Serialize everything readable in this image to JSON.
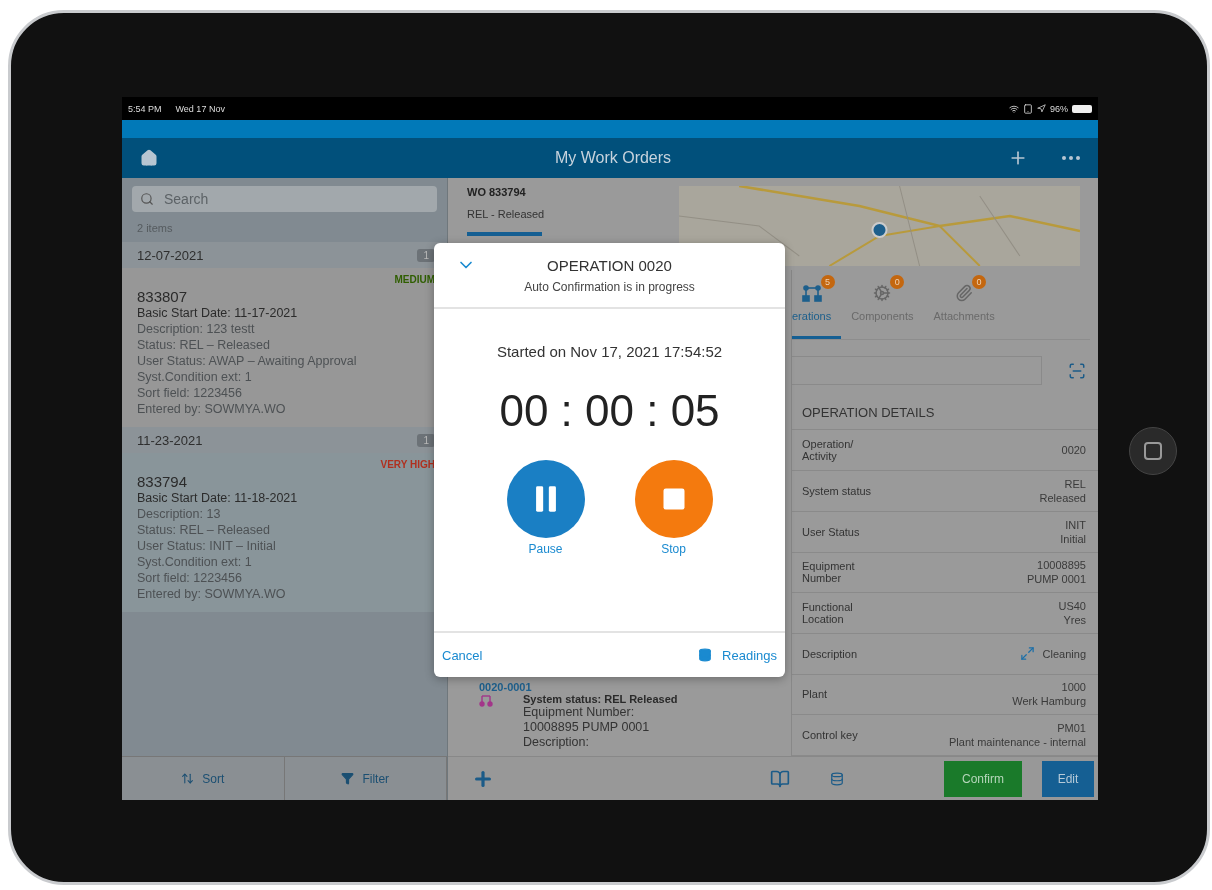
{
  "status_bar": {
    "time": "5:54 PM",
    "date": "Wed 17 Nov",
    "battery": "96%"
  },
  "nav": {
    "title": "My Work Orders"
  },
  "list": {
    "search_placeholder": "Search",
    "count": "2 items",
    "groups": [
      {
        "date": "12-07-2021",
        "count": "1",
        "orders": [
          {
            "id": "833807",
            "priority": "MEDIUM",
            "color": "#2f5e00",
            "selected": false,
            "start": "Basic Start Date: 11-17-2021",
            "lines": [
              "Description: 123 testt",
              "Status: REL – Released",
              "User Status:  AWAP – Awaiting Approval",
              "Syst.Condition ext: 1",
              "Sort field: 1223456",
              "Entered by: SOWMYA.WO"
            ]
          }
        ]
      },
      {
        "date": "11-23-2021",
        "count": "1",
        "orders": [
          {
            "id": "833794",
            "priority": "VERY HIGH",
            "color": "#b0301f",
            "selected": true,
            "start": "Basic Start Date: 11-18-2021",
            "lines": [
              "Description: 13",
              "Status: REL – Released",
              "User Status:  INIT – Initial",
              "Syst.Condition ext: 1",
              "Sort field: 1223456",
              "Entered by: SOWMYA.WO"
            ]
          }
        ]
      }
    ],
    "tools": [
      {
        "label": "Sort",
        "kind": "sort"
      },
      {
        "label": "Filter",
        "kind": "filter"
      }
    ]
  },
  "order": {
    "title": "WO 833794",
    "status": "REL - Released",
    "tabs": [
      {
        "label": "erations",
        "badge": "5",
        "kind": "operations",
        "selected": true
      },
      {
        "label": "Components",
        "badge": "0",
        "kind": "components",
        "selected": false
      },
      {
        "label": "Attachments",
        "badge": "0",
        "kind": "attachments",
        "selected": false
      }
    ],
    "details_heading": "OPERATION DETAILS",
    "details": [
      {
        "label": "Operation/ Activity",
        "values": [
          "0020"
        ],
        "kind": "text"
      },
      {
        "label": "System status",
        "values": [
          "REL",
          "Released"
        ],
        "kind": "text"
      },
      {
        "label": "User Status",
        "values": [
          "INIT",
          "Initial"
        ],
        "kind": "text"
      },
      {
        "label": "Equipment Number",
        "values": [
          "10008895",
          "PUMP 0001"
        ],
        "kind": "text"
      },
      {
        "label": "Functional Location",
        "values": [
          "US40",
          "Yres"
        ],
        "kind": "text"
      },
      {
        "label": "Description",
        "values": [
          "Cleaning"
        ],
        "kind": "expandable"
      },
      {
        "label": "Plant",
        "values": [
          "1000",
          "Werk Hamburg"
        ],
        "kind": "text"
      },
      {
        "label": "Control key",
        "values": [
          "PM01",
          "Plant maintenance - internal"
        ],
        "kind": "text"
      }
    ],
    "operation": {
      "code": "0020-0001",
      "status": "System status: REL Released",
      "lines": [
        "Equipment Number:",
        "10008895 PUMP 0001",
        "Description:"
      ]
    },
    "confirm": "Confirm",
    "edit": "Edit"
  },
  "modal": {
    "title": "OPERATION 0020",
    "subtitle": "Auto Confirmation is in progress",
    "started": "Started on Nov 17, 2021 17:54:52",
    "timer": "00 : 00 : 05",
    "actions": [
      {
        "label": "Pause",
        "kind": "pause"
      },
      {
        "label": "Stop",
        "kind": "stop"
      }
    ],
    "cancel": "Cancel",
    "readings": "Readings"
  }
}
